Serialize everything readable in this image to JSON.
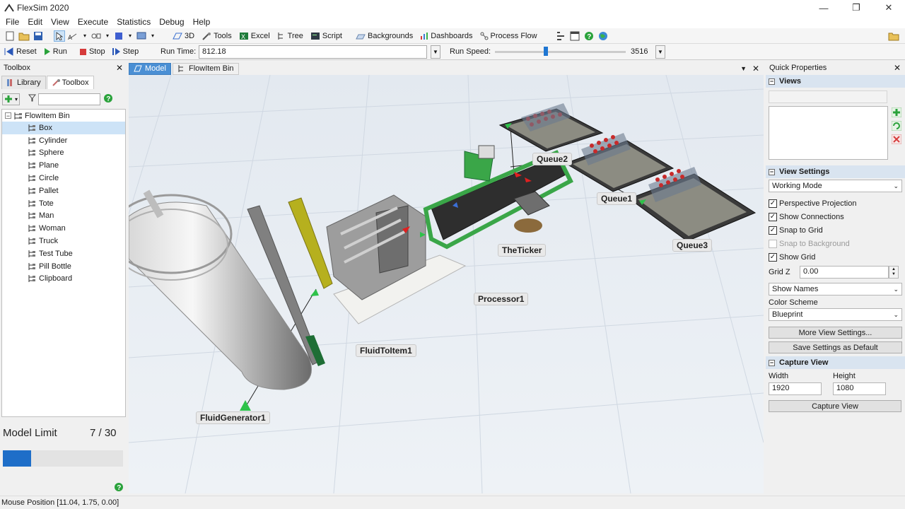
{
  "app": {
    "title": "FlexSim 2020"
  },
  "window_controls": {
    "minimize": "—",
    "maximize": "❐",
    "close": "✕"
  },
  "menu": [
    "File",
    "Edit",
    "View",
    "Execute",
    "Statistics",
    "Debug",
    "Help"
  ],
  "toolbar": {
    "items": [
      "3D",
      "Tools",
      "Excel",
      "Tree",
      "Script",
      "Backgrounds",
      "Dashboards",
      "Process Flow"
    ]
  },
  "run": {
    "reset": "Reset",
    "run": "Run",
    "stop": "Stop",
    "step": "Step",
    "run_time_label": "Run Time:",
    "run_time_value": "812.18",
    "run_speed_label": "Run Speed:",
    "run_speed_value": "3516",
    "run_speed_slider_fraction": 0.39
  },
  "left_panel": {
    "title": "Toolbox",
    "tabs": [
      "Library",
      "Toolbox"
    ],
    "tree_root": "FlowItem Bin",
    "items": [
      "Box",
      "Cylinder",
      "Sphere",
      "Plane",
      "Circle",
      "Pallet",
      "Tote",
      "Man",
      "Woman",
      "Truck",
      "Test Tube",
      "Pill Bottle",
      "Clipboard"
    ],
    "selected_index": 0,
    "model_limit_label": "Model Limit",
    "model_limit_value": "7 / 30",
    "model_limit_fraction": 0.233
  },
  "doc_tabs": [
    "Model",
    "FlowItem Bin"
  ],
  "model": {
    "labels": {
      "queue2": "Queue2",
      "queue1": "Queue1",
      "queue3": "Queue3",
      "ticker": "TheTicker",
      "processor": "Processor1",
      "fluid_to_item": "FluidToItem1",
      "fluid_generator": "FluidGenerator1"
    }
  },
  "quick_properties": {
    "title": "Quick Properties",
    "views_header": "Views",
    "view_settings_header": "View Settings",
    "working_mode": "Working Mode",
    "checks": [
      {
        "label": "Perspective Projection",
        "checked": true,
        "enabled": true
      },
      {
        "label": "Show Connections",
        "checked": true,
        "enabled": true
      },
      {
        "label": "Snap to Grid",
        "checked": true,
        "enabled": true
      },
      {
        "label": "Snap to Background",
        "checked": false,
        "enabled": false
      },
      {
        "label": "Show Grid",
        "checked": true,
        "enabled": true
      }
    ],
    "grid_z_label": "Grid Z",
    "grid_z_value": "0.00",
    "show_names": "Show Names",
    "color_scheme_label": "Color Scheme",
    "color_scheme_value": "Blueprint",
    "more_view_settings": "More View Settings...",
    "save_default": "Save Settings as Default",
    "capture_header": "Capture View",
    "width_label": "Width",
    "height_label": "Height",
    "width_value": "1920",
    "height_value": "1080",
    "capture_button": "Capture View"
  },
  "status": {
    "mouse_position": "Mouse Position [11.04, 1.75, 0.00]"
  },
  "colors": {
    "accent": "#1e6ec8",
    "tab_active": "#4a8fd4",
    "section_head": "#d9e4f0",
    "viewport_bg": "#e9eef3"
  }
}
